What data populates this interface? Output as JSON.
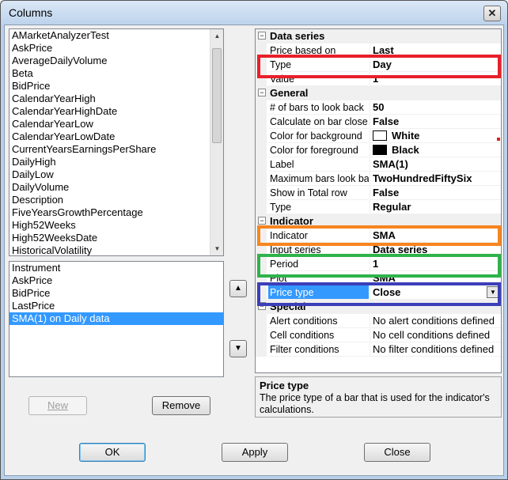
{
  "window": {
    "title": "Columns",
    "close_glyph": "✕"
  },
  "available_columns": [
    "AMarketAnalyzerTest",
    "AskPrice",
    "AverageDailyVolume",
    "Beta",
    "BidPrice",
    "CalendarYearHigh",
    "CalendarYearHighDate",
    "CalendarYearLow",
    "CalendarYearLowDate",
    "CurrentYearsEarningsPerShare",
    "DailyHigh",
    "DailyLow",
    "DailyVolume",
    "Description",
    "FiveYearsGrowthPercentage",
    "High52Weeks",
    "High52WeeksDate",
    "HistoricalVolatility"
  ],
  "selected_columns": [
    {
      "label": "Instrument",
      "selected": false
    },
    {
      "label": "AskPrice",
      "selected": false
    },
    {
      "label": "BidPrice",
      "selected": false
    },
    {
      "label": "LastPrice",
      "selected": false
    },
    {
      "label": "SMA(1) on Daily data",
      "selected": true
    }
  ],
  "buttons": {
    "new": "New",
    "remove": "Remove",
    "ok": "OK",
    "apply": "Apply",
    "close": "Close",
    "move_up_glyph": "▲",
    "move_down_glyph": "▼"
  },
  "scroll_glyphs": {
    "up": "▲",
    "down": "▼"
  },
  "expand_glyph": "−",
  "dropdown_glyph": "▼",
  "property_grid": {
    "data_series": {
      "title": "Data series",
      "rows": [
        {
          "name": "Price based on",
          "value": "Last"
        },
        {
          "name": "Type",
          "value": "Day"
        },
        {
          "name": "Value",
          "value": "1"
        }
      ]
    },
    "general": {
      "title": "General",
      "rows": [
        {
          "name": "# of bars to look back",
          "value": "50"
        },
        {
          "name": "Calculate on bar close",
          "value": "False"
        },
        {
          "name": "Color for background",
          "value": "White",
          "swatch": "#ffffff"
        },
        {
          "name": "Color for foreground",
          "value": "Black",
          "swatch": "#000000"
        },
        {
          "name": "Label",
          "value": "SMA(1)"
        },
        {
          "name": "Maximum bars look ba",
          "value": "TwoHundredFiftySix"
        },
        {
          "name": "Show in Total row",
          "value": "False"
        },
        {
          "name": "Type",
          "value": "Regular"
        }
      ]
    },
    "indicator": {
      "title": "Indicator",
      "rows": [
        {
          "name": "Indicator",
          "value": "SMA"
        },
        {
          "name": "Input series",
          "value": "Data series"
        },
        {
          "name": "Period",
          "value": "1"
        },
        {
          "name": "Plot",
          "value": "SMA"
        },
        {
          "name": "Price type",
          "value": "Close"
        }
      ]
    },
    "special": {
      "title": "Special",
      "rows": [
        {
          "name": "Alert conditions",
          "value": "No alert conditions defined"
        },
        {
          "name": "Cell conditions",
          "value": "No cell conditions defined"
        },
        {
          "name": "Filter conditions",
          "value": "No filter conditions defined"
        }
      ]
    }
  },
  "description": {
    "title": "Price type",
    "text": "The price type of a bar that is used for the indicator's calculations."
  },
  "highlight_colors": {
    "red": "#e8202a",
    "orange": "#f7851f",
    "green": "#2eb34a",
    "blue": "#3b3fb8"
  }
}
